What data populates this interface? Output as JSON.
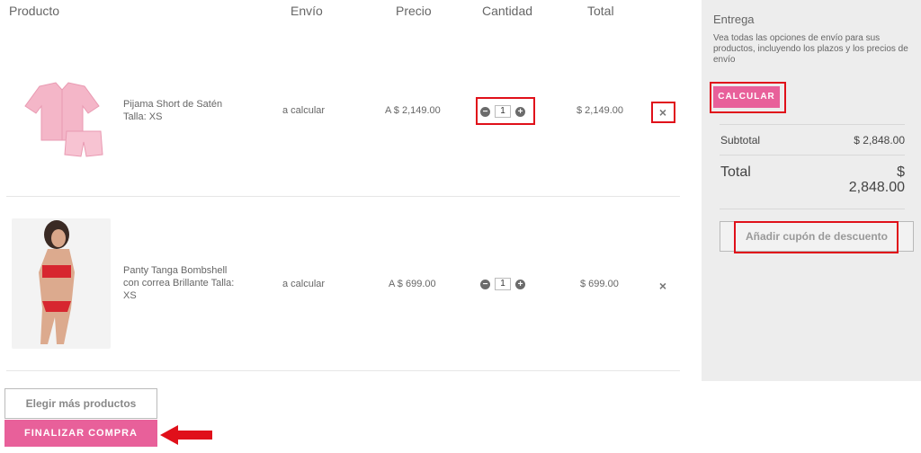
{
  "header": {
    "product": "Producto",
    "shipping": "Envío",
    "price": "Precio",
    "quantity": "Cantidad",
    "total": "Total"
  },
  "items": [
    {
      "name": "Pijama Short de Satén Talla: XS",
      "shipping": "a calcular",
      "price": "A $ 2,149.00",
      "qty": "1",
      "total": "$ 2,149.00"
    },
    {
      "name": "Panty Tanga Bombshell con correa Brillante Talla: XS",
      "shipping": "a calcular",
      "price": "A $ 699.00",
      "qty": "1",
      "total": "$ 699.00"
    }
  ],
  "summary": {
    "delivery_title": "Entrega",
    "delivery_desc": "Vea todas las opciones de envío para sus productos, incluyendo los plazos y los precios de envío",
    "calc_label": "CALCULAR",
    "subtotal_label": "Subtotal",
    "subtotal_value": "$ 2,848.00",
    "total_label": "Total",
    "total_currency": "$",
    "total_value": "2,848.00",
    "coupon_label": "Añadir cupón de descuento"
  },
  "actions": {
    "more_label": "Elegir más productos",
    "checkout_label": "FINALIZAR COMPRA"
  },
  "icons": {
    "minus": "minus-icon",
    "plus": "plus-icon",
    "remove": "close-icon"
  },
  "colors": {
    "accent": "#e8609a",
    "highlight": "#e0101a",
    "panel_bg": "#ededed"
  }
}
